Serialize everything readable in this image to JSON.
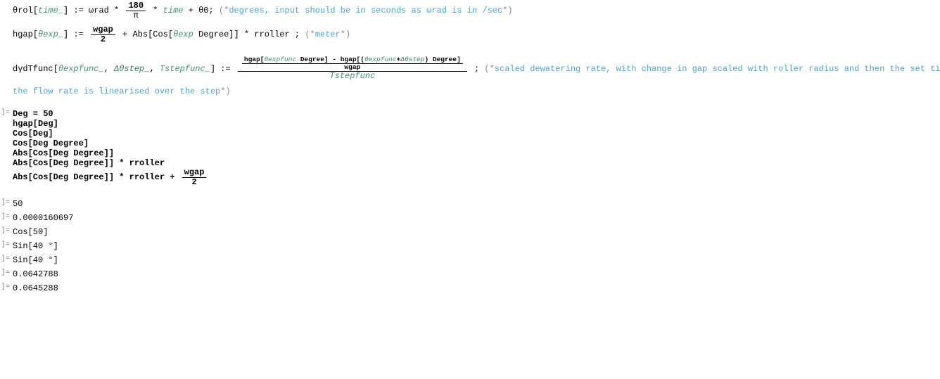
{
  "defs": {
    "line1": {
      "fn": "θrol",
      "param": "time_",
      "assign": " := ωrad * ",
      "frac_num": "180",
      "frac_den": "π",
      "tail": " * ",
      "time": "time",
      "plus": " + θ0; ",
      "comment_open": "(*",
      "comment_body": "degrees, input should be in seconds as ωrad is in /sec",
      "comment_close": "*)"
    },
    "line2": {
      "fn": "hgap",
      "param": "θexp_",
      "assign": " := ",
      "frac_num": "wgap",
      "frac_den": "2",
      "plus": " + Abs[Cos[",
      "theta": "θexp",
      "deg": " Degree]] * rroller ; ",
      "comment_open": "(*",
      "comment_body": "meter",
      "comment_close": "*)"
    },
    "line3": {
      "fn": "dγdTfunc",
      "p1": "θexpfunc_",
      "p2": "Δθstep_",
      "p3": "Tstepfunc_",
      "assign": " := ",
      "hgap_num_a": "hgap[",
      "hgap_num_b": "θexpfunc",
      "hgap_num_c": " Degree] - hgap[(",
      "hgap_num_d": "θexpfunc",
      "hgap_num_e": "+",
      "hgap_num_f": "Δθstep",
      "hgap_num_g": ") Degree]",
      "inner_den": "wgap",
      "outer_den": "Tstepfunc",
      "tail": " ; ",
      "comment_open": "(*",
      "comment_body": "scaled dewatering rate, with change in gap scaled with roller radius and then the set time time step,",
      "comment_close": ""
    },
    "line3b": {
      "text": "the flow rate is linearised over the step",
      "close": "*)"
    }
  },
  "inputs": {
    "l1": "Deg = 50",
    "l2": "hgap[Deg]",
    "l3": "Cos[Deg]",
    "l4": "Cos[Deg Degree]",
    "l5": "Abs[Cos[Deg Degree]]",
    "l6": "Abs[Cos[Deg Degree]] * rroller",
    "l7_a": "Abs[Cos[Deg Degree]] * rroller + ",
    "l7_frac_num": "wgap",
    "l7_frac_den": "2"
  },
  "outputs": {
    "o1": "50",
    "o2": "0.0000160697",
    "o3": "Cos[50]",
    "o4": "Sin[40 °]",
    "o5": "Sin[40 °]",
    "o6": "0.0642788",
    "o7": "0.0645288"
  }
}
